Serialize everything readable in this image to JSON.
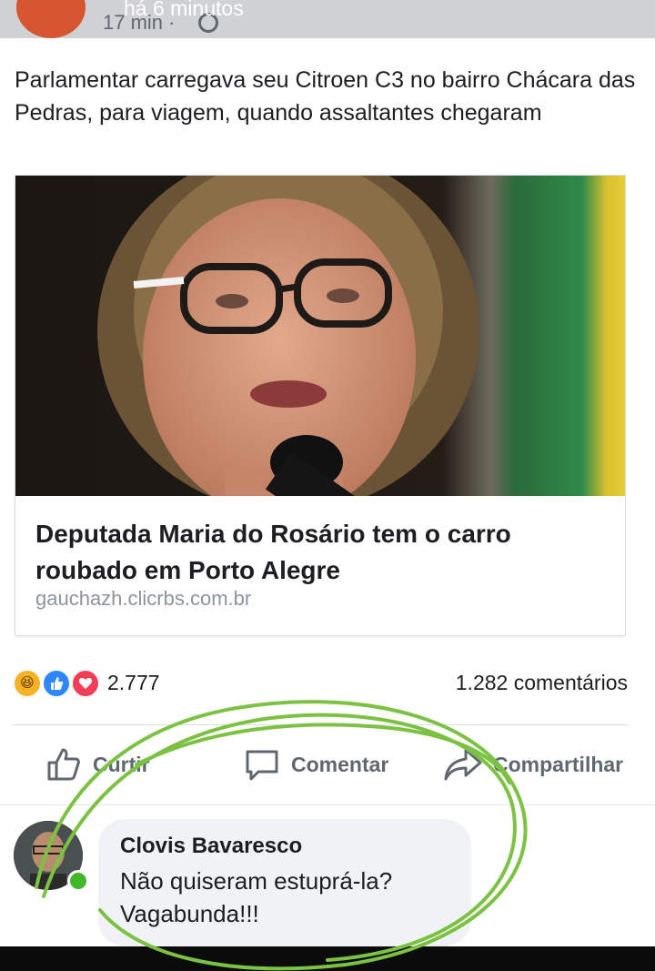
{
  "overlay": {
    "text": "há 6 minutos"
  },
  "post": {
    "time": "17 min ·",
    "text": "Parlamentar carregava seu Citroen C3 no bairro Chácara das Pedras, para viagem, quando assaltantes chegaram"
  },
  "link": {
    "title": "Deputada Maria do Rosário tem o carro roubado em Porto Alegre",
    "domain": "gauchazh.clicrbs.com.br"
  },
  "stats": {
    "reactions": "2.777",
    "comments": "1.282 comentários"
  },
  "actions": {
    "like": "Curtir",
    "comment": "Comentar",
    "share": "Compartilhar"
  },
  "comment": {
    "author": "Clovis Bavaresco",
    "text": "Não quiseram estuprá-la? Vagabunda!!!"
  },
  "colors": {
    "accent": "#2d88ff",
    "love": "#f33e58",
    "haha": "#f7b125",
    "scribble": "#7cc242"
  }
}
